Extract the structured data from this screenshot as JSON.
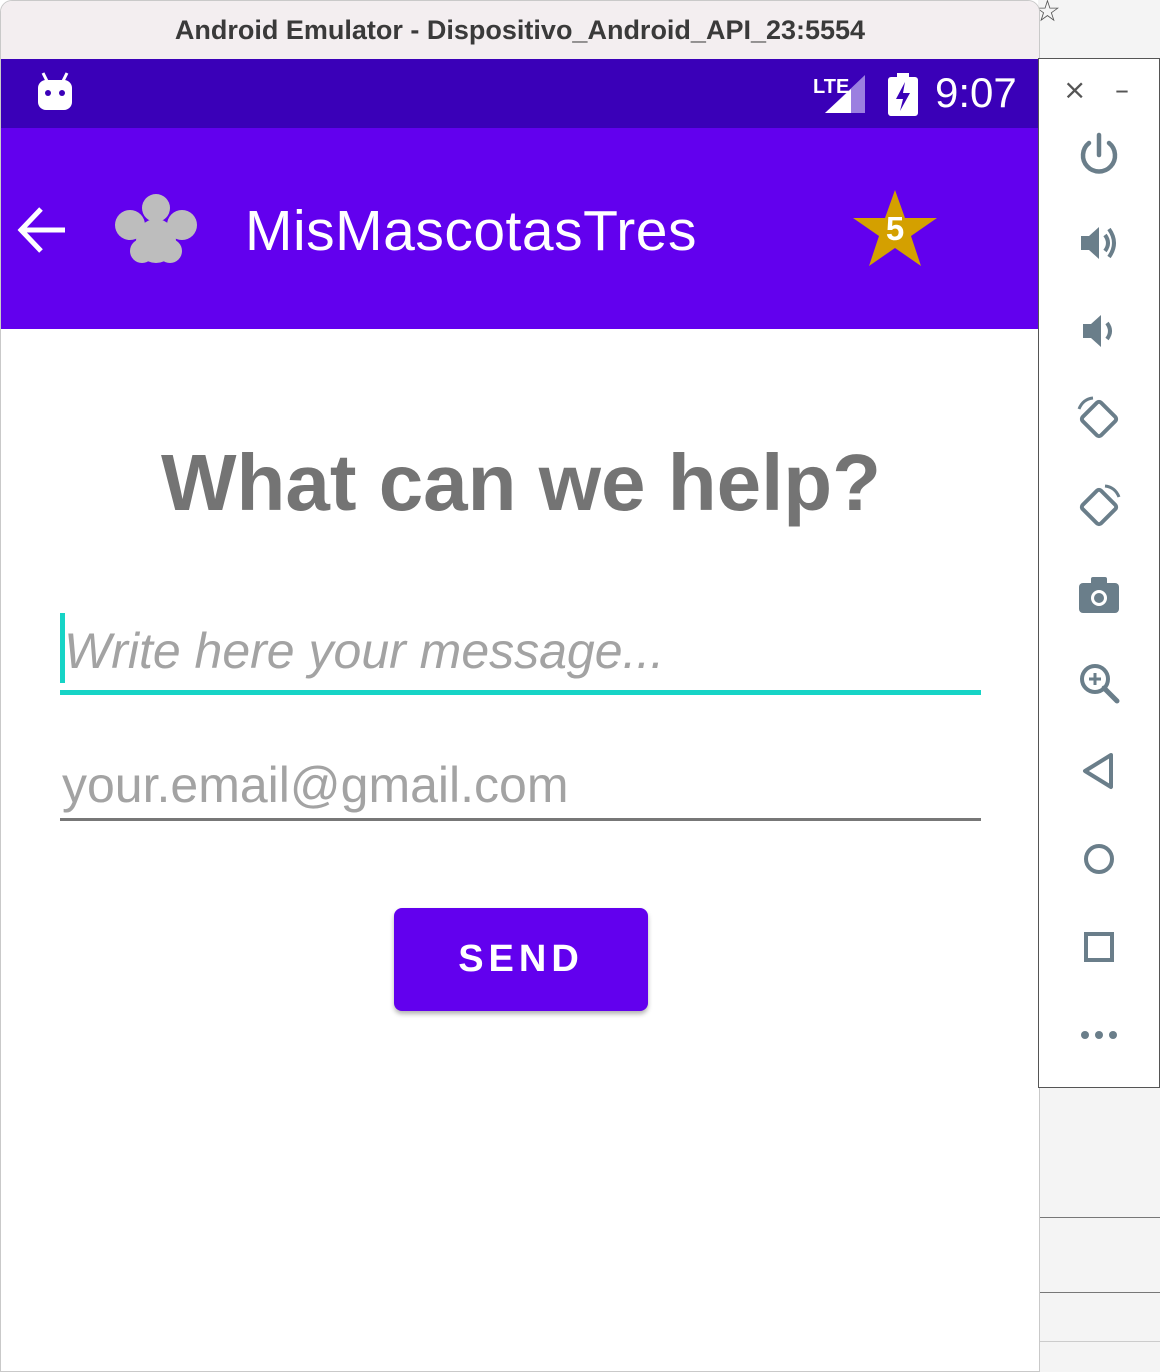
{
  "window": {
    "title": "Android Emulator - Dispositivo_Android_API_23:5554"
  },
  "status_bar": {
    "time": "9:07",
    "network_label": "LTE"
  },
  "app_bar": {
    "title": "MisMascotasTres",
    "badge_count": "5",
    "colors": {
      "app_bar": "#6200ee",
      "status_bar": "#3a00b8",
      "badge": "#d4a000"
    }
  },
  "form": {
    "heading": "What can we help?",
    "message_placeholder": "Write here your message...",
    "email_placeholder": "your.email@gmail.com",
    "send_label": "SEND",
    "accent_color": "#16d4c6"
  },
  "emulator_toolbar": {
    "close_label": "×",
    "minimize_label": "–",
    "tools": [
      "power-icon",
      "volume-up-icon",
      "volume-down-icon",
      "rotate-left-icon",
      "rotate-right-icon",
      "camera-icon",
      "zoom-icon",
      "back-icon",
      "home-icon",
      "overview-icon",
      "more-icon"
    ]
  }
}
